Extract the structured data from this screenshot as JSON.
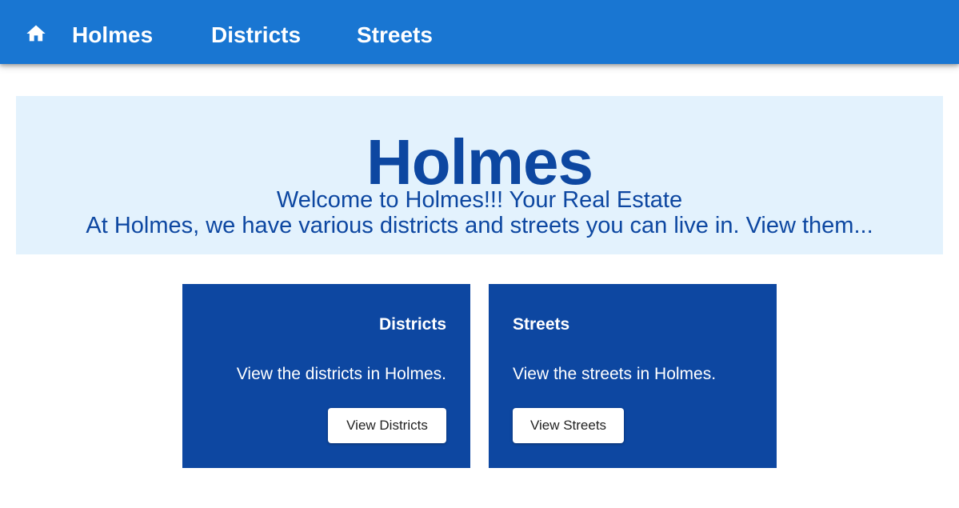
{
  "nav": {
    "home_icon": "home-icon",
    "brand": "Holmes",
    "links": [
      {
        "label": "Districts"
      },
      {
        "label": "Streets"
      }
    ]
  },
  "hero": {
    "title": "Holmes",
    "welcome": "Welcome to Holmes!!! Your Real Estate",
    "description": "At Holmes, we have various districts and streets you can live in. View them..."
  },
  "cards": [
    {
      "title": "Districts",
      "text": "View the districts in Holmes.",
      "button": "View Districts"
    },
    {
      "title": "Streets",
      "text": "View the streets in Holmes.",
      "button": "View Streets"
    }
  ],
  "colors": {
    "appbar": "#1976d2",
    "hero_bg": "#e3f2fd",
    "primary_dark": "#0d47a1",
    "text_on_dark": "#ffffff"
  }
}
